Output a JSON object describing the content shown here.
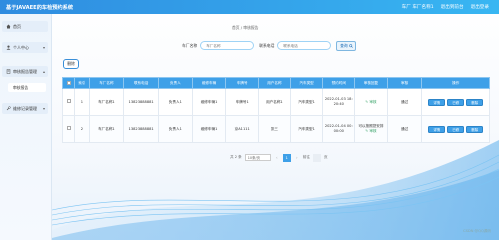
{
  "app": {
    "title": "基于JAVAEE的车检预约系统",
    "top_links": [
      "车厂 车厂名称1",
      "退出到前台",
      "退出登录"
    ]
  },
  "sidebar": {
    "items": [
      {
        "label": "首页",
        "icon": "home-icon"
      },
      {
        "label": "个人中心",
        "icon": "user-icon",
        "arrow": "▾"
      },
      {
        "label": "审核报告管理",
        "icon": "document-icon",
        "arrow": "▴"
      },
      {
        "label": "维修记录管理",
        "icon": "wrench-icon",
        "arrow": "▾"
      }
    ],
    "subitems": [
      "审核报告"
    ]
  },
  "breadcrumb": "首页 / 审核报告",
  "search": {
    "label1": "车厂名称",
    "placeholder1": "车厂名称",
    "label2": "联系电话",
    "placeholder2": "联系电话",
    "button": "查询"
  },
  "toolbar": {
    "delete": "删除"
  },
  "table": {
    "headers": [
      "",
      "索引",
      "车厂名称",
      "联系电话",
      "负责人",
      "维修车辆",
      "车牌号",
      "用户名称",
      "汽车类型",
      "预约时间",
      "审核回复",
      "审核",
      "操作"
    ],
    "rows": [
      [
        "",
        "1",
        "车厂名称1",
        "13823888881",
        "负责人1",
        "维修车辆1",
        "车牌号1",
        "用户名称1",
        "汽车类型1",
        "2022-01-03 18:20:40",
        "",
        "通过",
        ""
      ],
      [
        "",
        "2",
        "车厂名称1",
        "13823888881",
        "负责人1",
        "维修车辆1",
        "京A1111",
        "张三",
        "汽车类型1",
        "2022-01-04 00:00:00",
        "可以按照您安排",
        "通过",
        ""
      ]
    ],
    "edit_label": "✎ 审核",
    "op_buttons": [
      "详情",
      "已修",
      "删除"
    ]
  },
  "pagination": {
    "total": "共 2 条",
    "page_size": "10条/页",
    "prev": "‹",
    "pages": [
      "1"
    ],
    "next": "›",
    "goto": "前往",
    "goto_suffix": "页"
  },
  "watermark": "CSDN @QQ源码"
}
